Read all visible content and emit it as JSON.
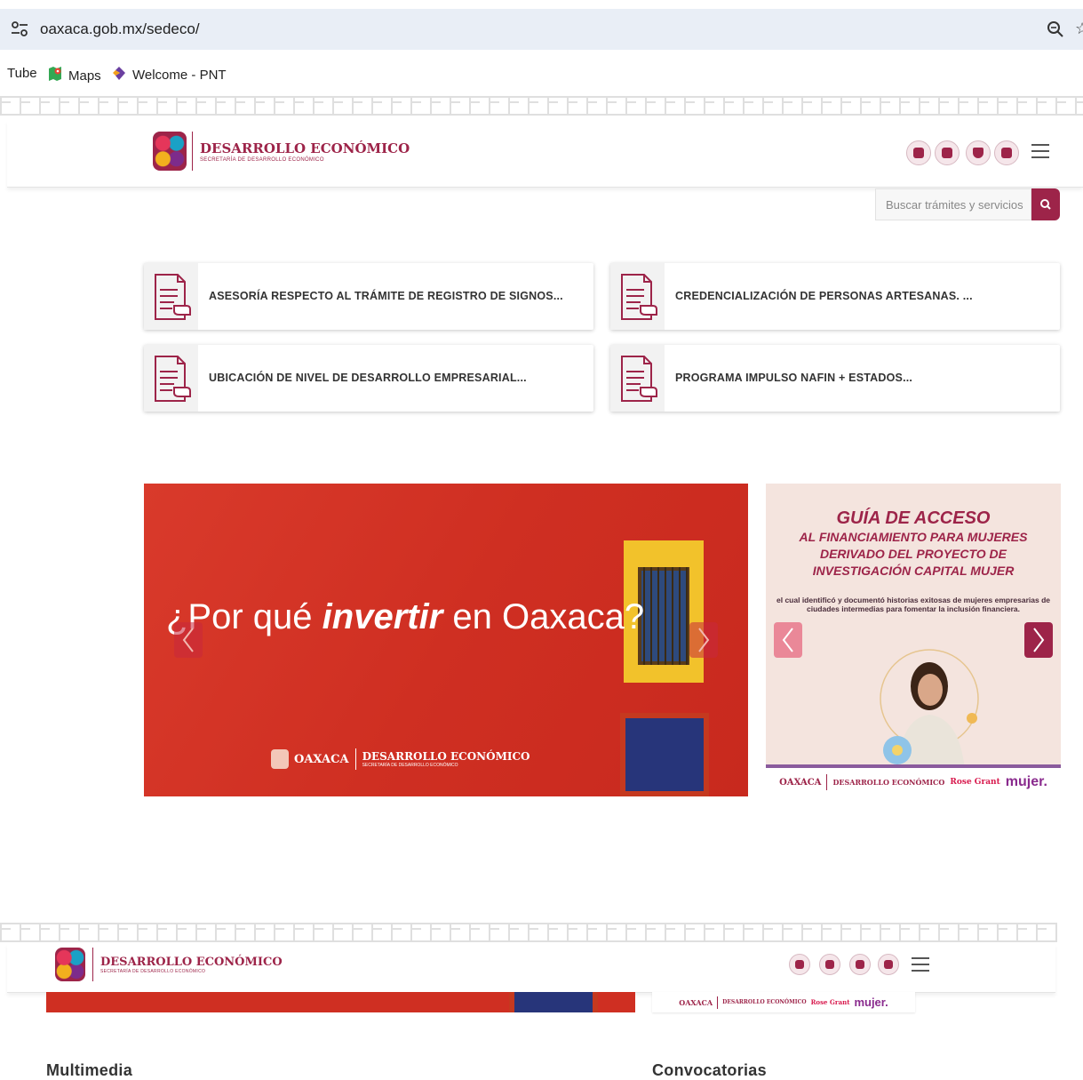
{
  "browser": {
    "url": "oaxaca.gob.mx/sedeco/",
    "bookmarks": [
      "Tube",
      "Maps",
      "Welcome - PNT"
    ]
  },
  "header": {
    "title": "DESARROLLO ECONÓMICO",
    "subtitle": "SECRETARÍA DE DESARROLLO ECONÓMICO"
  },
  "search": {
    "placeholder": "Buscar trámites y servicios"
  },
  "procedures": [
    "ASESORÍA RESPECTO AL TRÁMITE DE REGISTRO DE SIGNOS...",
    "CREDENCIALIZACIÓN DE PERSONAS ARTESANAS. ...",
    "UBICACIÓN DE NIVEL DE DESARROLLO EMPRESARIAL...",
    "PROGRAMA IMPULSO NAFIN + ESTADOS..."
  ],
  "banner_invest": {
    "pre": "¿Por qué ",
    "emph": "invertir",
    "post": " en Oaxaca?",
    "logo_left": "OAXACA",
    "logo_right": "DESARROLLO ECONÓMICO",
    "logo_sub": "SECRETARÍA DE DESARROLLO ECONÓMICO"
  },
  "banner_guide": {
    "title": "GUÍA DE ACCESO",
    "line1": "AL FINANCIAMIENTO PARA MUJERES",
    "line2": "DERIVADO DEL PROYECTO DE",
    "line3": "INVESTIGACIÓN CAPITAL MUJER",
    "description": "el cual identificó y documentó historias exitosas de mujeres empresarias de ciudades intermedias para fomentar la inclusión financiera.",
    "footer_oaxaca": "OAXACA",
    "footer_de": "DESARROLLO ECONÓMICO",
    "footer_rose": "Rose Grant",
    "footer_mujer": "mujer."
  },
  "sections": {
    "multimedia": "Multimedia",
    "convocatorias": "Convocatorias"
  },
  "colors": {
    "brand": "#9d2449",
    "banner_red": "#cf2f22"
  }
}
